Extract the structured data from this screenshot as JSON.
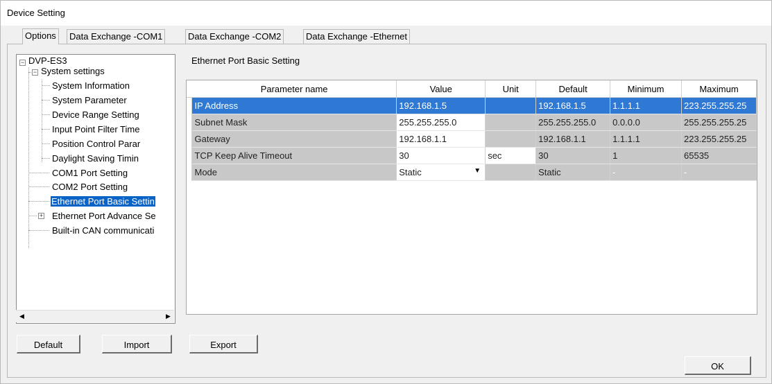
{
  "window": {
    "title": "Device Setting"
  },
  "tabs": [
    {
      "label": "Options"
    },
    {
      "label": "Data Exchange -COM1"
    },
    {
      "label": "Data Exchange -COM2"
    },
    {
      "label": "Data Exchange -Ethernet"
    }
  ],
  "tree": {
    "root": "DVP-ES3",
    "system_settings": "System settings",
    "system_children": [
      "System Information",
      "System Parameter",
      "Device Range Setting",
      "Input Point Filter Time",
      "Position Control Parar",
      "Daylight Saving Timin"
    ],
    "com1": "COM1 Port Setting",
    "com2": "COM2 Port Setting",
    "eth_basic": "Ethernet Port Basic Settin",
    "eth_advance": "Ethernet Port Advance Se",
    "can": "Built-in CAN communicati"
  },
  "section_title": "Ethernet Port Basic Setting",
  "grid": {
    "headers": [
      "Parameter name",
      "Value",
      "Unit",
      "Default",
      "Minimum",
      "Maximum"
    ],
    "rows": [
      [
        "IP Address",
        "192.168.1.5",
        "",
        "192.168.1.5",
        "1.1.1.1",
        "223.255.255.25"
      ],
      [
        "Subnet Mask",
        "255.255.255.0",
        "",
        "255.255.255.0",
        "0.0.0.0",
        "255.255.255.25"
      ],
      [
        "Gateway",
        "192.168.1.1",
        "",
        "192.168.1.1",
        "1.1.1.1",
        "223.255.255.25"
      ],
      [
        "TCP Keep Alive Timeout",
        "30",
        "sec",
        "30",
        "1",
        "65535"
      ],
      [
        "Mode",
        "Static",
        "",
        "Static",
        "-",
        "-"
      ]
    ]
  },
  "buttons": {
    "default": "Default",
    "import": "Import",
    "export": "Export",
    "ok": "OK"
  }
}
